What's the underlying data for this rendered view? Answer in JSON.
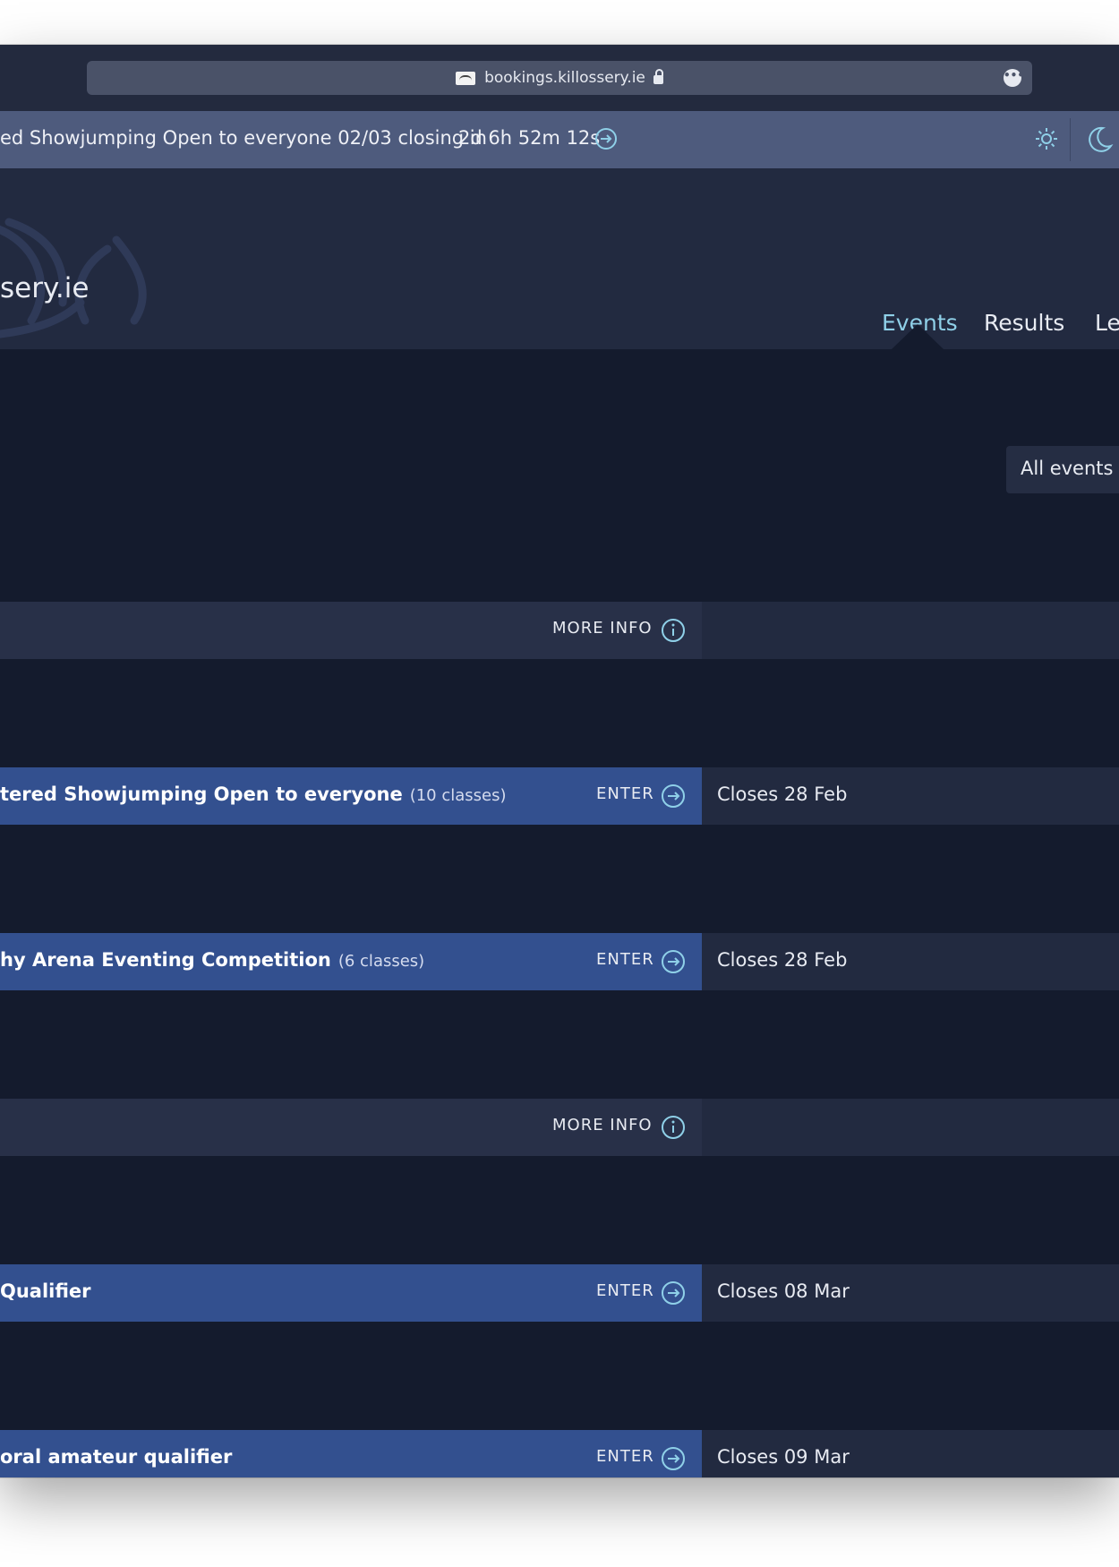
{
  "browser": {
    "url": "bookings.killossery.ie"
  },
  "announcement": {
    "text": "ed Showjumping Open to everyone 02/03 closing in",
    "countdown": "2d 6h 52m 12s"
  },
  "header": {
    "logo_text": "sery.ie",
    "nav": [
      {
        "label": "Events",
        "active": true
      },
      {
        "label": "Results"
      },
      {
        "label": "Le"
      }
    ]
  },
  "filter": {
    "label": "All events"
  },
  "rows": [
    {
      "type": "header",
      "action": "MORE  INFO"
    },
    {
      "type": "event",
      "title": "tered Showjumping Open to everyone",
      "count": "(10 classes)",
      "action": "ENTER",
      "closes": "Closes 28 Feb"
    },
    {
      "type": "event",
      "title": "hy Arena Eventing Competition",
      "count": "(6 classes)",
      "action": "ENTER",
      "closes": "Closes 28 Feb"
    },
    {
      "type": "header",
      "action": "MORE  INFO"
    },
    {
      "type": "event",
      "title": "Qualifier",
      "count": "",
      "action": "ENTER",
      "closes": "Closes 08 Mar"
    },
    {
      "type": "event",
      "title": "oral amateur qualifier",
      "count": "",
      "action": "ENTER",
      "closes": "Closes 09 Mar"
    }
  ],
  "colors": {
    "accent": "#8fd0e8",
    "event_row": "#33508f",
    "background": "#141b2d"
  }
}
